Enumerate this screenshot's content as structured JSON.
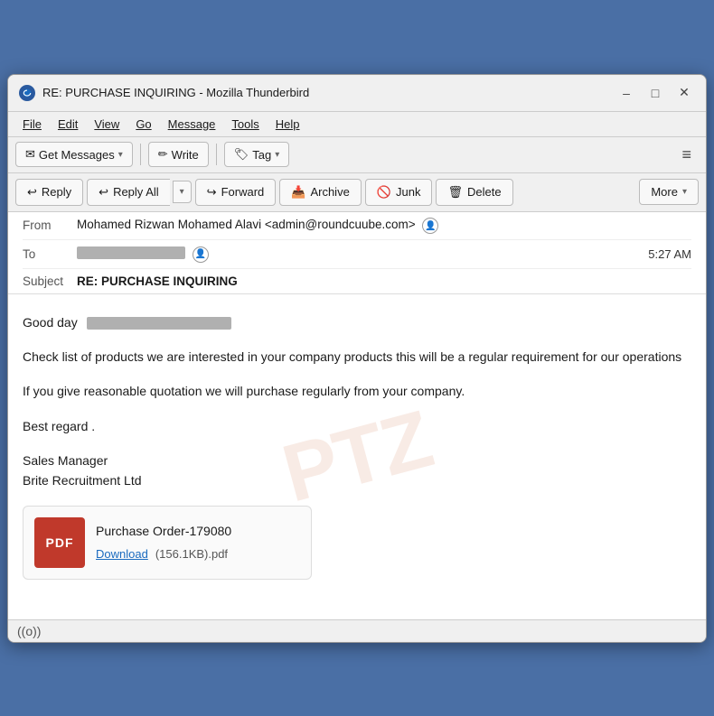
{
  "window": {
    "title": "RE: PURCHASE INQUIRING - Mozilla Thunderbird",
    "icon_label": "thunderbird-icon"
  },
  "menu": {
    "items": [
      "File",
      "Edit",
      "View",
      "Go",
      "Message",
      "Tools",
      "Help"
    ]
  },
  "toolbar": {
    "get_messages_label": "Get Messages",
    "write_label": "Write",
    "tag_label": "Tag",
    "hamburger": "≡"
  },
  "actions": {
    "reply_label": "Reply",
    "reply_all_label": "Reply All",
    "forward_label": "Forward",
    "archive_label": "Archive",
    "junk_label": "Junk",
    "delete_label": "Delete",
    "more_label": "More"
  },
  "email": {
    "from_label": "From",
    "from_value": "Mohamed Rizwan Mohamed Alavi <admin@roundcuube.com>",
    "to_label": "To",
    "to_blurred": true,
    "time": "5:27 AM",
    "subject_label": "Subject",
    "subject_value": "RE: PURCHASE INQUIRING",
    "body": {
      "greeting": "Good day",
      "para1": "Check list of products we are interested in your company products this will be a regular requirement for our operations",
      "para2": "If you give reasonable quotation we will purchase regularly from your company.",
      "para3": "Best regard .",
      "signature1": "Sales Manager",
      "signature2": "Brite Recruitment Ltd"
    },
    "attachment": {
      "type": "PDF",
      "name": "Purchase Order-179080",
      "download_label": "Download",
      "size": "(156.1KB).pdf"
    }
  },
  "statusbar": {
    "wifi_icon": "((o))"
  }
}
